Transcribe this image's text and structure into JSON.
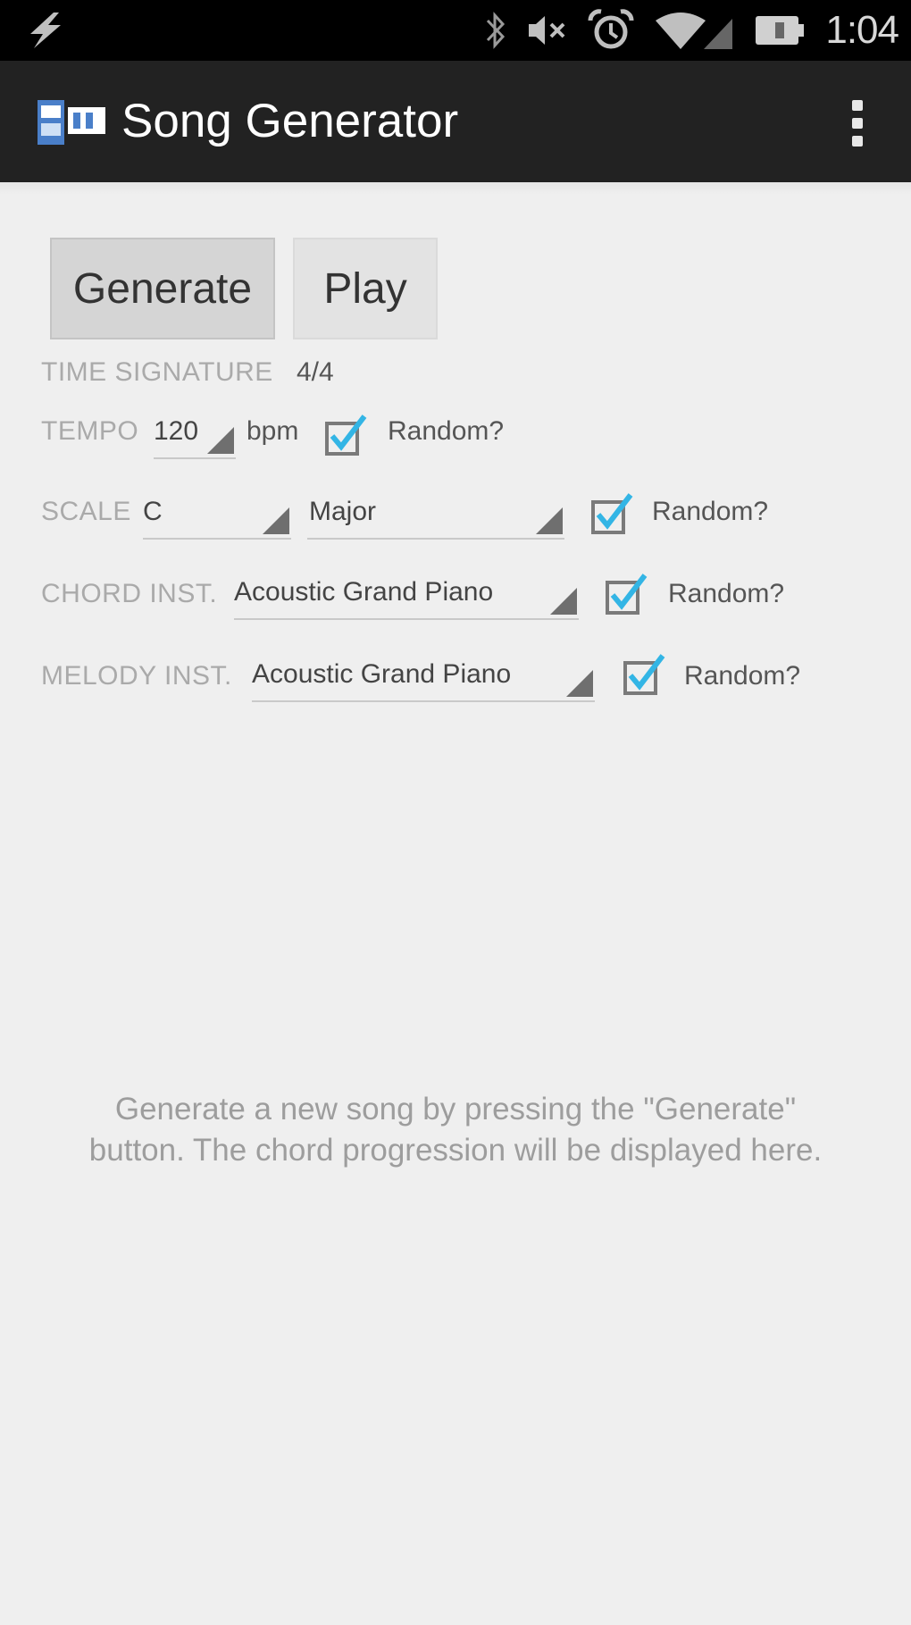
{
  "status_bar": {
    "time": "1:04",
    "icons": [
      "bolt-icon",
      "bluetooth-icon",
      "muted-volume-icon",
      "alarm-icon",
      "wifi-icon",
      "battery-icon"
    ]
  },
  "action_bar": {
    "title": "Song Generator",
    "app_icon": "app-icon",
    "overflow_icon": "overflow-menu-icon"
  },
  "buttons": {
    "generate": "Generate",
    "play": "Play"
  },
  "time_signature": {
    "label": "TIME SIGNATURE",
    "value": "4/4"
  },
  "tempo": {
    "label": "TEMPO",
    "value": "120",
    "unit": "bpm",
    "random_label": "Random?",
    "random_checked": true
  },
  "scale": {
    "label": "SCALE",
    "key": "C",
    "mode": "Major",
    "random_label": "Random?",
    "random_checked": true
  },
  "chord_inst": {
    "label": "CHORD INST.",
    "value": "Acoustic Grand Piano",
    "random_label": "Random?",
    "random_checked": true
  },
  "melody_inst": {
    "label": "MELODY INST.",
    "value": "Acoustic Grand Piano",
    "random_label": "Random?",
    "random_checked": true
  },
  "hint": "Generate a new song by pressing the \"Generate\" button. The chord progression will be displayed here.",
  "colors": {
    "action_bar": "#222222",
    "background": "#efefef",
    "checkmark": "#33b5e5",
    "label": "#aaaaaa"
  }
}
